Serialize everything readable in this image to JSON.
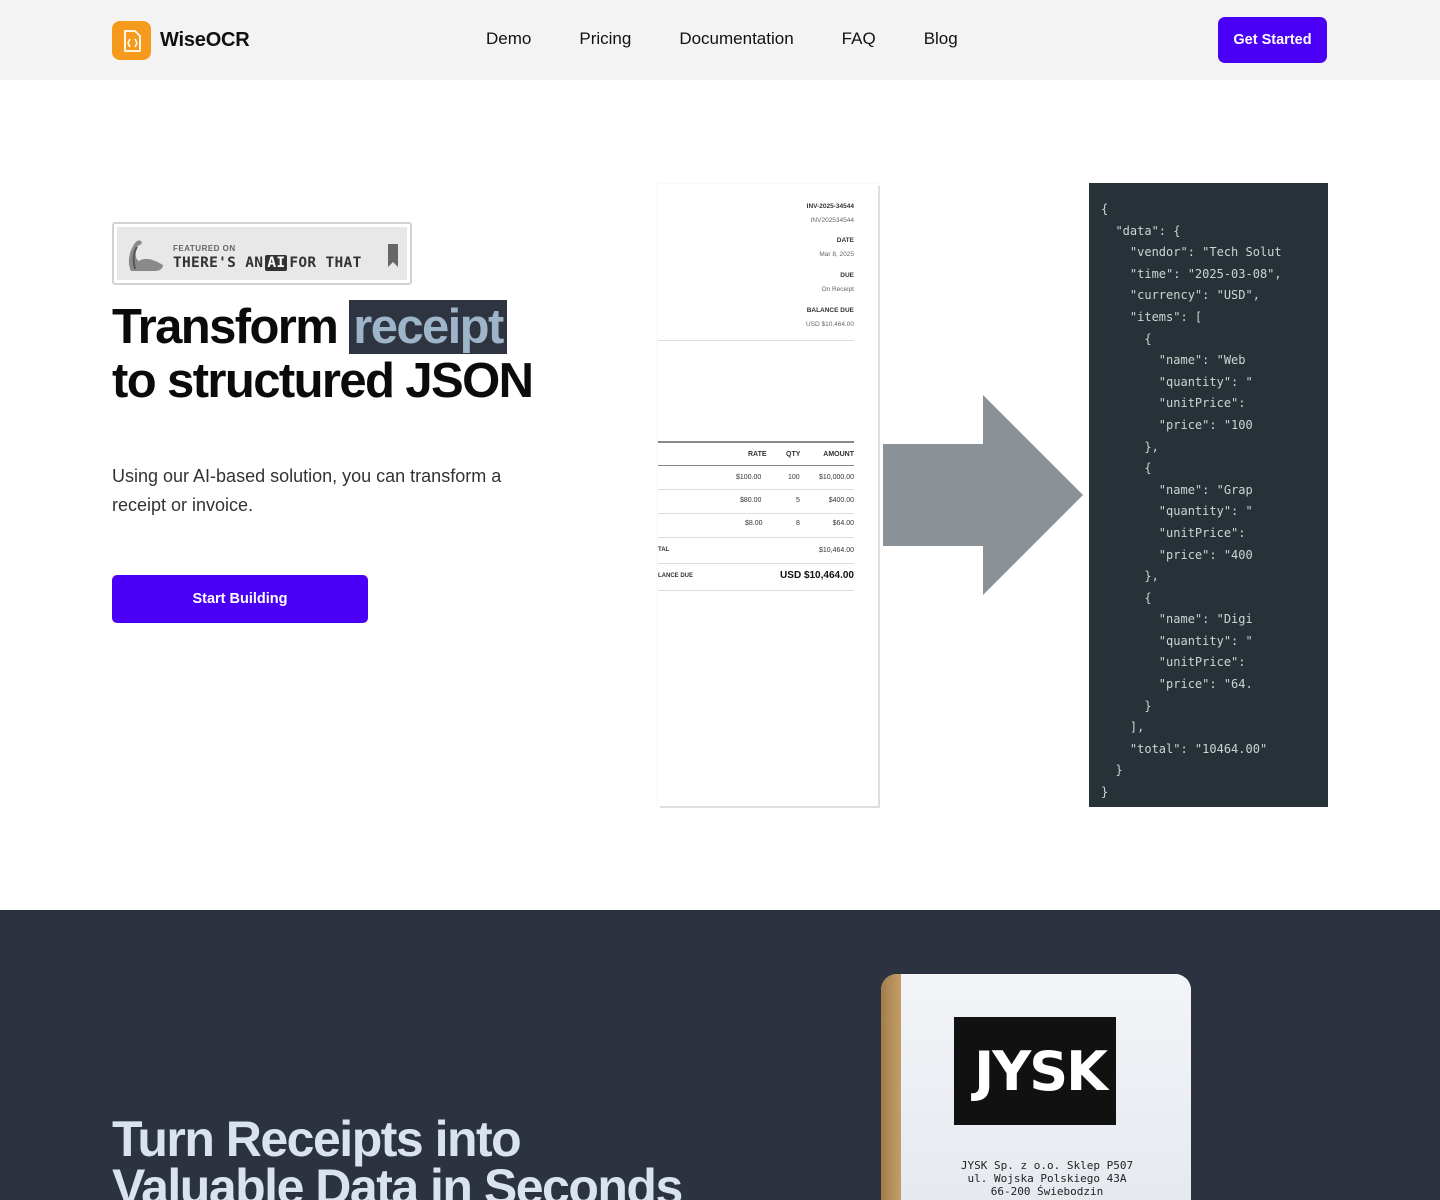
{
  "brand": {
    "name": "WiseOCR",
    "logo_icon": "code-file-icon",
    "accent": "#4a00f7",
    "logo_color": "#f59a1a"
  },
  "nav": {
    "links": [
      "Demo",
      "Pricing",
      "Documentation",
      "FAQ",
      "Blog"
    ],
    "cta": "Get Started"
  },
  "hero": {
    "featured_small": "FEATURED ON",
    "featured_pre": "THERE'S AN",
    "featured_ai": "AI",
    "featured_post": "FOR THAT",
    "title_part1": "Transform ",
    "title_highlight": "receipt",
    "title_part2": "to structured JSON",
    "subtitle": "Using our AI-based solution, you can transform a receipt or invoice.",
    "cta": "Start Building"
  },
  "invoice": {
    "number_label": "INV-2025-34544",
    "number": "INV202534544",
    "date_label": "DATE",
    "date": "Mar 8, 2025",
    "due_label": "DUE",
    "due": "On Receipt",
    "balance_label": "BALANCE DUE",
    "balance": "USD $10,464.00",
    "headers": [
      "RATE",
      "QTY",
      "AMOUNT"
    ],
    "rows": [
      [
        "$100.00",
        "100",
        "$10,000.00"
      ],
      [
        "$80.00",
        "5",
        "$400.00"
      ],
      [
        "$8.00",
        "8",
        "$64.00"
      ]
    ],
    "total_label": "TAL",
    "total": "$10,464.00",
    "balance_due_label": "LANCE DUE",
    "balance_due": "USD $10,464.00"
  },
  "json_lines": [
    "{",
    "  \"data\": {",
    "    \"vendor\": \"Tech Solut",
    "    \"time\": \"2025-03-08\",",
    "    \"currency\": \"USD\",",
    "    \"items\": [",
    "      {",
    "        \"name\": \"Web",
    "        \"quantity\": \"",
    "        \"unitPrice\":",
    "        \"price\": \"100",
    "      },",
    "      {",
    "        \"name\": \"Grap",
    "        \"quantity\": \"",
    "        \"unitPrice\":",
    "        \"price\": \"400",
    "      },",
    "      {",
    "        \"name\": \"Digi",
    "        \"quantity\": \"",
    "        \"unitPrice\":",
    "        \"price\": \"64.",
    "      }",
    "    ],",
    "    \"total\": \"10464.00\"",
    "  }",
    "}"
  ],
  "section2": {
    "title_line1": "Turn Receipts into",
    "title_line2": "Valuable Data in Seconds"
  },
  "receipt": {
    "brand": "JYSK",
    "lines": [
      "JYSK Sp. z o.o. Sklep P507",
      "ul. Wojska Polskiego 43A",
      "66-200 Świebodzin"
    ]
  }
}
